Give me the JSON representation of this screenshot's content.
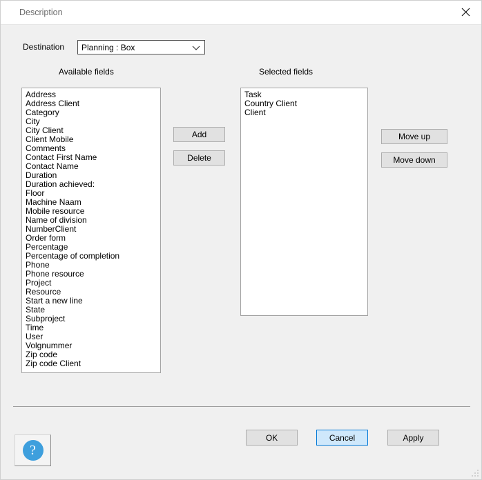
{
  "window": {
    "title": "Description",
    "close_label": "close-icon"
  },
  "form": {
    "destination_label": "Destination",
    "destination_value": "Planning : Box",
    "destination_options": [
      "Planning : Box"
    ]
  },
  "available": {
    "caption": "Available fields",
    "items": [
      "Address",
      "Address Client",
      "Category",
      "City",
      "City Client",
      "Client Mobile",
      "Comments",
      "Contact First Name",
      "Contact Name",
      "Duration",
      "Duration achieved:",
      "Floor",
      "Machine Naam",
      "Mobile resource",
      "Name of division",
      "NumberClient",
      "Order form",
      "Percentage",
      "Percentage of completion",
      "Phone",
      "Phone resource",
      "Project",
      "Resource",
      "Start a new line",
      "State",
      "Subproject",
      "Time",
      "User",
      "Volgnummer",
      "Zip code",
      "Zip code Client"
    ]
  },
  "selected": {
    "caption": "Selected fields",
    "items": [
      "Task",
      "Country Client",
      "Client"
    ]
  },
  "transfer_buttons": {
    "add": "Add",
    "delete": "Delete"
  },
  "order_buttons": {
    "move_up": "Move up",
    "move_down": "Move down"
  },
  "footer": {
    "ok": "OK",
    "cancel": "Cancel",
    "apply": "Apply",
    "help": "?"
  },
  "colors": {
    "window_bg": "#f0f0f0",
    "titlebar_bg": "#ffffff",
    "title_text": "#6b6b6b",
    "button_face": "#e1e1e1",
    "button_border": "#adadad",
    "focus_fill": "#cfe8fb",
    "focus_border": "#0078d7",
    "help_icon": "#3e9fdd",
    "list_border": "#a4a4a4"
  }
}
